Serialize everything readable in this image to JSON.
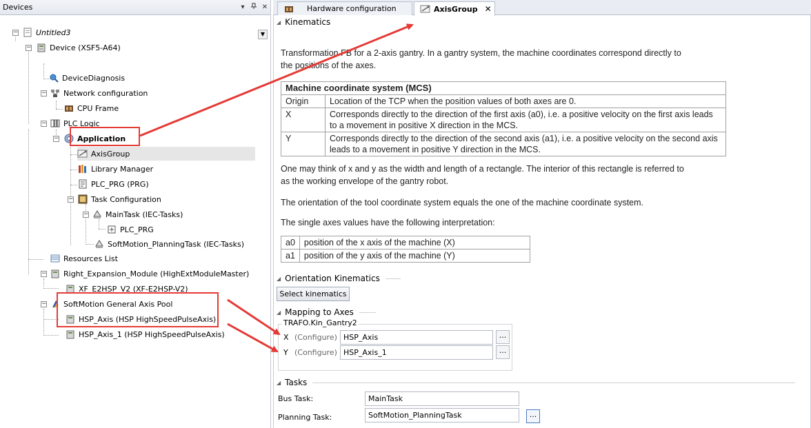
{
  "devices_pane": {
    "title": "Devices",
    "pin_glyph": "▾",
    "pushpin_glyph": "ⵖ",
    "close_glyph": "✕"
  },
  "tree": {
    "root": "Untitled3",
    "device": "Device (XSF5-A64)",
    "device_diagnosis": "DeviceDiagnosis",
    "network_configuration": "Network configuration",
    "cpu_frame": "CPU Frame",
    "plc_logic": "PLC Logic",
    "application": "Application",
    "axis_group": "AxisGroup",
    "library_manager": "Library Manager",
    "plc_prg": "PLC_PRG (PRG)",
    "task_configuration": "Task Configuration",
    "main_task": "MainTask (IEC-Tasks)",
    "main_task_plc_prg": "PLC_PRG",
    "softmotion_planning_task": "SoftMotion_PlanningTask (IEC-Tasks)",
    "resources_list": "Resources List",
    "right_expansion_module": "Right_Expansion_Module (HighExtModuleMaster)",
    "xf_e2hsp": "XF_E2HSP_V2 (XF-E2HSP-V2)",
    "softmotion_axis_pool": "SoftMotion General Axis Pool",
    "hsp_axis": "HSP_Axis (HSP HighSpeedPulseAxis)",
    "hsp_axis_1": "HSP_Axis_1 (HSP HighSpeedPulseAxis)"
  },
  "tabs": [
    {
      "label": "Hardware configuration",
      "active": false
    },
    {
      "label": "AxisGroup",
      "active": true,
      "close_glyph": "✕"
    }
  ],
  "kinematics": {
    "heading": "Kinematics",
    "intro_line1": "Transformation FB for a 2-axis gantry. In a gantry system, the machine coordinates correspond directly to",
    "intro_line2": "the positions of the axes.",
    "mcs_table": {
      "title": "Machine coordinate system (MCS)",
      "rows": [
        {
          "key": "Origin",
          "value": "Location of the TCP when the position values of both axes are 0."
        },
        {
          "key": "X",
          "value": "Corresponds directly to the direction of the first axis (a0), i.e. a positive velocity on the first axis leads to a movement in positive X direction in the MCS."
        },
        {
          "key": "Y",
          "value": "Corresponds directly to the direction of the second axis (a1), i.e. a positive velocity on the second axis leads to a movement in positive Y direction in the MCS."
        }
      ]
    },
    "para_envelope_1": "One may think of x and y as the width and length of a rectangle. The interior of this rectangle is referred to",
    "para_envelope_2": "as the working envelope of the gantry robot.",
    "para_orientation": "The orientation of the tool coordinate system equals the one of the machine coordinate system.",
    "para_axes": "The single axes values have the following interpretation:",
    "axes_table": [
      {
        "key": "a0",
        "value": "position of the x axis of the machine (X)"
      },
      {
        "key": "a1",
        "value": "position of the y axis of the machine (Y)"
      }
    ]
  },
  "orientation_kinematics": {
    "heading": "Orientation Kinematics",
    "select_button": "Select kinematics"
  },
  "mapping": {
    "heading": "Mapping to Axes",
    "group_title": "TRAFO.Kin_Gantry2",
    "rows": [
      {
        "axis": "X",
        "configure": "(Configure)",
        "value": "HSP_Axis",
        "btn": "..."
      },
      {
        "axis": "Y",
        "configure": "(Configure)",
        "value": "HSP_Axis_1",
        "btn": "..."
      }
    ]
  },
  "tasks": {
    "heading": "Tasks",
    "bus_task_label": "Bus Task:",
    "bus_task_value": "MainTask",
    "planning_task_label": "Planning Task:",
    "planning_task_value": "SoftMotion_PlanningTask",
    "planning_btn": "..."
  },
  "colors": {
    "highlight": "#e53935",
    "panel_header": "#e9ecf2"
  }
}
